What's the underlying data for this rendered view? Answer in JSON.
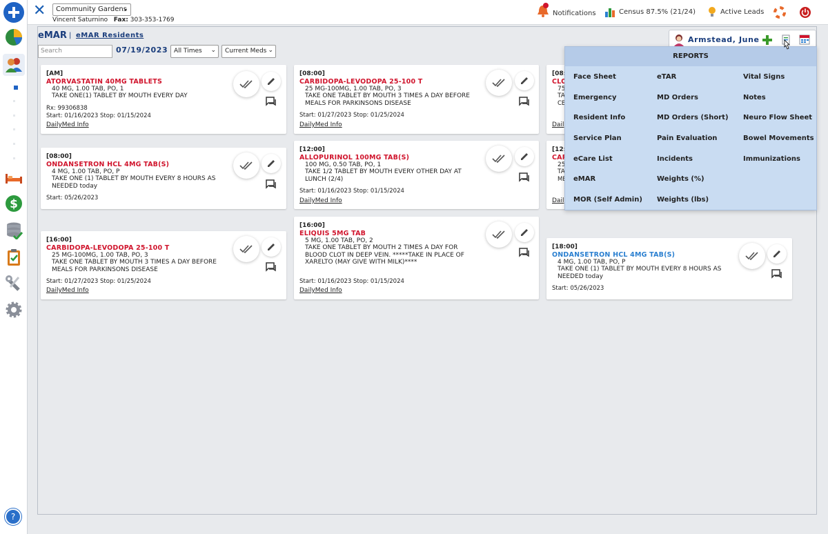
{
  "header": {
    "facility": "Community Gardens",
    "user_name": "Vincent Saturnino",
    "fax_label": "Fax:",
    "fax_number": "303-353-1769",
    "notifications": "Notifications",
    "census": "Census 87.5% (21/24)",
    "active_leads": "Active Leads"
  },
  "page": {
    "title": "eMAR",
    "separator": "|",
    "residents_link": "eMAR Residents",
    "search_placeholder": "Search",
    "date": "07/19/2023",
    "times_filter": "All Times",
    "meds_filter": "Current Meds"
  },
  "resident": {
    "name": "Armstead, June"
  },
  "cards": [
    {
      "time": "[AM]",
      "med": "ATORVASTATIN 40MG TABLETS",
      "dose": "40 MG, 1.00 TAB, PO, 1",
      "instr": "TAKE ONE(1) TABLET BY MOUTH EVERY DAY",
      "rx": "Rx: 99306838",
      "startstop": "Start: 01/16/2023 Stop: 01/15/2024",
      "link": "DailyMed Info"
    },
    {
      "time": "[08:00]",
      "med": "CARBIDOPA-LEVODOPA 25-100 T",
      "dose": "25 MG-100MG, 1.00 TAB, PO, 3",
      "instr": "TAKE ONE TABLET BY MOUTH 3 TIMES A DAY BEFORE MEALS FOR PARKINSONS DISEASE",
      "startstop": "Start: 01/27/2023 Stop: 01/25/2024",
      "link": "DailyMed Info"
    },
    {
      "time": "[08:00]",
      "med": "ONDANSETRON HCL 4MG TAB(S)",
      "dose": "4 MG, 1.00 TAB, PO, P",
      "instr": "TAKE ONE (1) TABLET BY MOUTH EVERY 8 HOURS AS NEEDED today",
      "startstop": "Start: 05/26/2023"
    },
    {
      "time": "[12:00]",
      "med": "ALLOPURINOL 100MG TAB(S)",
      "dose": "100 MG, 0.50 TAB, PO, 1",
      "instr": "TAKE 1/2 TABLET BY MOUTH EVERY OTHER DAY AT LUNCH (2/4)",
      "startstop": "Start: 01/16/2023 Stop: 01/15/2024",
      "link": "DailyMed Info"
    },
    {
      "time": "[16:00]",
      "med": "CARBIDOPA-LEVODOPA 25-100 T",
      "dose": "25 MG-100MG, 1.00 TAB, PO, 3",
      "instr": "TAKE ONE TABLET BY MOUTH 3 TIMES A DAY BEFORE MEALS FOR PARKINSONS DISEASE",
      "startstop": "Start: 01/27/2023 Stop: 01/25/2024",
      "link": "DailyMed Info"
    },
    {
      "time": "[16:00]",
      "med": "ELIQUIS 5MG TAB",
      "dose": "5 MG, 1.00 TAB, PO, 2",
      "instr": "TAKE ONE TABLET BY MOUTH 2 TIMES A DAY FOR BLOOD CLOT IN DEEP VEIN. *****TAKE IN PLACE OF XARELTO (MAY GIVE WITH MILK)****",
      "startstop": "Start: 01/16/2023 Stop: 01/15/2024",
      "link": "DailyMed Info"
    },
    {
      "time": "[18:00]",
      "med": "ONDANSETRON HCL 4MG TAB(S)",
      "dose": "4 MG, 1.00 TAB, PO, P",
      "instr": "TAKE ONE (1) TABLET BY MOUTH EVERY 8 HOURS AS NEEDED today",
      "startstop": "Start: 05/26/2023"
    },
    {
      "time": "[08:",
      "med": "CLO",
      "dose": "75",
      "instr": "TA",
      "extra": "CE"
    },
    {
      "time": "[12:",
      "med": "CAR",
      "dose": "25",
      "instr": "TA",
      "extra": "ME"
    }
  ],
  "partial_links": {
    "one": "Dail",
    "two": "Dail"
  },
  "reports": {
    "title": "REPORTS",
    "col1": [
      "Face Sheet",
      "Emergency",
      "Resident Info",
      "Service Plan",
      "eCare List",
      "eMAR",
      "MOR (Self Admin)"
    ],
    "col2": [
      "eTAR",
      "MD Orders",
      "MD Orders (Short)",
      "Pain Evaluation",
      "Incidents",
      "Weights (%)",
      "Weights (lbs)"
    ],
    "col3": [
      "Vital Signs",
      "Notes",
      "Neuro Flow Sheet",
      "Bowel Movements",
      "Immunizations"
    ]
  },
  "colors": {
    "accent": "#1a3d7c",
    "med_red": "#d0142c",
    "med_blue": "#2a7fd0",
    "reports_bg": "#c9dcf2"
  }
}
